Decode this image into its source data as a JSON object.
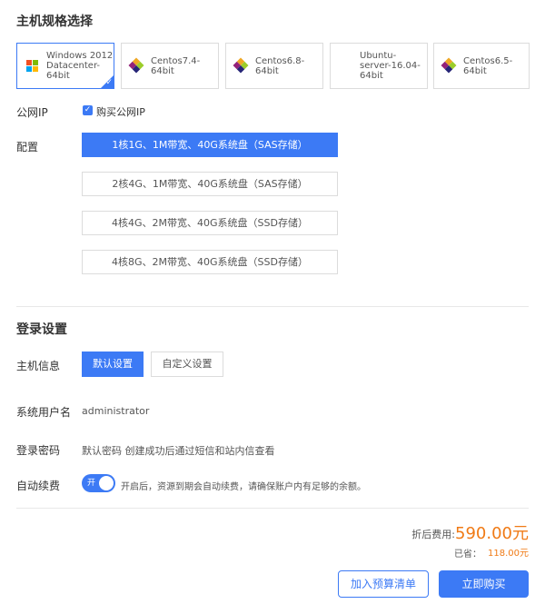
{
  "sections": {
    "host_spec_title": "主机规格选择",
    "login_title": "登录设置"
  },
  "os_options": [
    {
      "label": "Windows 2012 Datacenter-64bit",
      "icon": "windows-icon",
      "selected": true
    },
    {
      "label": "Centos7.4-64bit",
      "icon": "centos-icon",
      "selected": false
    },
    {
      "label": "Centos6.8-64bit",
      "icon": "centos-icon",
      "selected": false
    },
    {
      "label": "Ubuntu-server-16.04-64bit",
      "icon": "ubuntu-icon",
      "selected": false
    },
    {
      "label": "Centos6.5-64bit",
      "icon": "centos-icon",
      "selected": false
    }
  ],
  "public_ip": {
    "label": "公网IP",
    "checkbox_label": "购买公网IP",
    "checked": true
  },
  "config": {
    "label": "配置",
    "options": [
      "1核1G、1M带宽、40G系统盘（SAS存储）",
      "2核4G、1M带宽、40G系统盘（SAS存储）",
      "4核4G、2M带宽、40G系统盘（SSD存储）",
      "4核8G、2M带宽、40G系统盘（SSD存储）"
    ],
    "active_index": 0
  },
  "login": {
    "host_info_label": "主机信息",
    "default_setting": "默认设置",
    "custom_setting": "自定义设置",
    "username_label": "系统用户名",
    "username_value": "administrator",
    "password_label": "登录密码",
    "password_value": "默认密码 创建成功后通过短信和站内信查看",
    "renew_label": "自动续费",
    "toggle_on_text": "开",
    "renew_desc": "开启后，资源到期会自动续费，请确保账户内有足够的余额。"
  },
  "price": {
    "discount_label": "折后费用:",
    "discount_value": "590.00元",
    "saved_label": "已省：",
    "saved_value": "118.00元"
  },
  "actions": {
    "add_to_list": "加入预算清单",
    "buy_now": "立即购买"
  },
  "colors": {
    "accent": "#3c7af5",
    "price": "#f07a15"
  }
}
